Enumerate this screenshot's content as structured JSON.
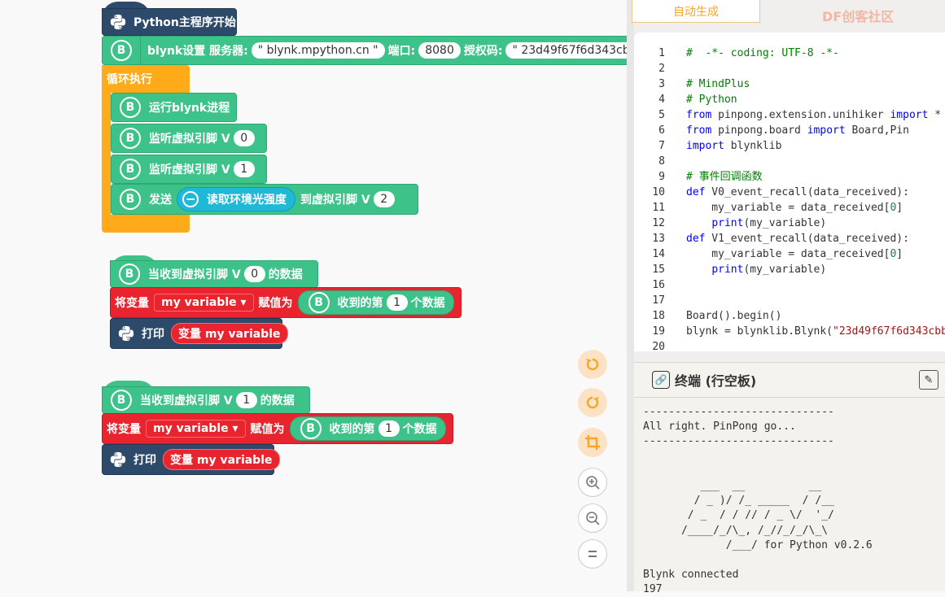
{
  "blocks": {
    "start": {
      "label": "Python主程序开始"
    },
    "blynk_setup": {
      "prefix": "blynk设置 服务器:",
      "server": "\" blynk.mpython.cn \"",
      "port_label": "端口:",
      "port": "8080",
      "auth_label": "授权码:",
      "auth": "\" 23d49f67f6d343cb"
    },
    "loop": {
      "label": "循环执行"
    },
    "run_blynk": {
      "label": "运行blynk进程"
    },
    "listen0": {
      "label": "监听虚拟引脚 V",
      "pin": "0"
    },
    "listen1": {
      "label": "监听虚拟引脚 V",
      "pin": "1"
    },
    "send": {
      "label": "发送",
      "sensor": "读取环境光强度",
      "to": "到虚拟引脚 V",
      "pin": "2"
    },
    "event0": {
      "when": "当收到虚拟引脚 V",
      "pin": "0",
      "suffix": "的数据",
      "assign_prefix": "将变量",
      "var": "my variable ▾",
      "assign_mid": "赋值为",
      "recv": "收到的第",
      "idx": "1",
      "recv_suffix": "个数据",
      "print": "打印",
      "print_var": "变量 my variable"
    },
    "event1": {
      "when": "当收到虚拟引脚 V",
      "pin": "1",
      "suffix": "的数据",
      "assign_prefix": "将变量",
      "var": "my variable ▾",
      "assign_mid": "赋值为",
      "recv": "收到的第",
      "idx": "1",
      "recv_suffix": "个数据",
      "print": "打印",
      "print_var": "变量 my variable"
    },
    "b_letter": "B"
  },
  "tools": [
    "undo-icon",
    "redo-icon",
    "crop-icon",
    "zoom-in-icon",
    "zoom-out-icon",
    "reset-zoom-icon"
  ],
  "tab": {
    "auto_generate": "自动生成"
  },
  "watermark": "DF创客社区",
  "code": {
    "lines": [
      {
        "n": "1",
        "t": "#  -*- coding: UTF-8 -*-"
      },
      {
        "n": "2",
        "t": ""
      },
      {
        "n": "3",
        "t": "# MindPlus"
      },
      {
        "n": "4",
        "t": "# Python"
      },
      {
        "n": "5",
        "t": "from pinpong.extension.unihiker import *"
      },
      {
        "n": "6",
        "t": "from pinpong.board import Board,Pin"
      },
      {
        "n": "7",
        "t": "import blynklib"
      },
      {
        "n": "8",
        "t": ""
      },
      {
        "n": "9",
        "t": "# 事件回调函数"
      },
      {
        "n": "10",
        "t": "def V0_event_recall(data_received):"
      },
      {
        "n": "11",
        "t": "    my_variable = data_received[0]"
      },
      {
        "n": "12",
        "t": "    print(my_variable)"
      },
      {
        "n": "13",
        "t": "def V1_event_recall(data_received):"
      },
      {
        "n": "14",
        "t": "    my_variable = data_received[0]"
      },
      {
        "n": "15",
        "t": "    print(my_variable)"
      },
      {
        "n": "16",
        "t": ""
      },
      {
        "n": "17",
        "t": ""
      },
      {
        "n": "18",
        "t": "Board().begin()"
      },
      {
        "n": "19",
        "t": "blynk = blynklib.Blynk(\"23d49f67f6d343cbbc"
      },
      {
        "n": "20",
        "t": ""
      }
    ]
  },
  "terminal": {
    "title": "终端 (行空板)",
    "lines": [
      "------------------------------",
      "All right. PinPong go...",
      "------------------------------",
      "",
      "",
      "         ___  __          __",
      "        / _ )/ /_ _____  / /__",
      "       / _  / / // / _ \\/  '_/",
      "      /____/_/\\_, /_//_/_/\\_\\",
      "             /___/ for Python v0.2.6",
      "",
      "Blynk connected",
      "197"
    ]
  },
  "colors": {
    "green": "#3dc28a",
    "darkblue": "#2d4a6b",
    "red": "#e8252e",
    "orange": "#ffab19",
    "accent": "#f5a623"
  }
}
